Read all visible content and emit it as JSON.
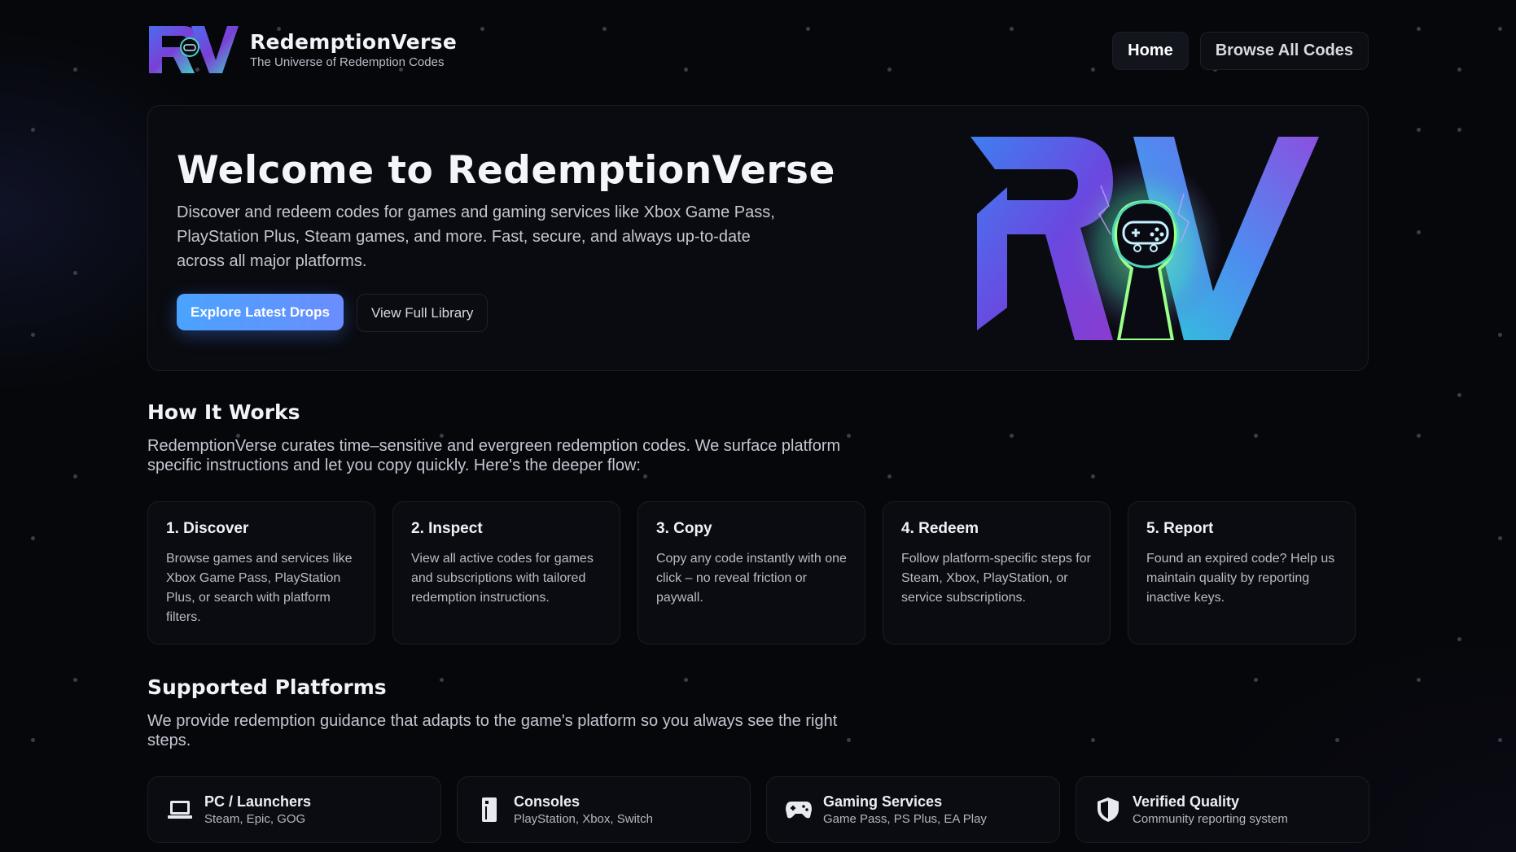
{
  "brand": {
    "name": "RedemptionVerse",
    "tagline": "The Universe of Redemption Codes",
    "logo_letters": "RV"
  },
  "nav": {
    "home": "Home",
    "browse": "Browse All Codes",
    "active": "Home"
  },
  "hero": {
    "title": "Welcome to RedemptionVerse",
    "description": "Discover and redeem codes for games and gaming services like Xbox Game Pass, PlayStation Plus, Steam games, and more. Fast, secure, and always up-to-date across all major platforms.",
    "primary_cta": "Explore Latest Drops",
    "secondary_cta": "View Full Library"
  },
  "how_it_works": {
    "title": "How It Works",
    "description": "RedemptionVerse curates time–sensitive and evergreen redemption codes. We surface platform specific instructions and let you copy quickly. Here's the deeper flow:",
    "steps": [
      {
        "title": "1. Discover",
        "text": "Browse games and services like Xbox Game Pass, PlayStation Plus, or search with platform filters."
      },
      {
        "title": "2. Inspect",
        "text": "View all active codes for games and subscriptions with tailored redemption instructions."
      },
      {
        "title": "3. Copy",
        "text": "Copy any code instantly with one click – no reveal friction or paywall."
      },
      {
        "title": "4. Redeem",
        "text": "Follow platform-specific steps for Steam, Xbox, PlayStation, or service subscriptions."
      },
      {
        "title": "5. Report",
        "text": "Found an expired code? Help us maintain quality by reporting inactive keys."
      }
    ]
  },
  "supported_platforms": {
    "title": "Supported Platforms",
    "description": "We provide redemption guidance that adapts to the game's platform so you always see the right steps.",
    "items": [
      {
        "name": "PC / Launchers",
        "sub": "Steam, Epic, GOG",
        "icon": "laptop-icon"
      },
      {
        "name": "Consoles",
        "sub": "PlayStation, Xbox, Switch",
        "icon": "console-icon"
      },
      {
        "name": "Gaming Services",
        "sub": "Game Pass, PS Plus, EA Play",
        "icon": "gamepad-icon"
      },
      {
        "name": "Verified Quality",
        "sub": "Community reporting system",
        "icon": "shield-icon"
      }
    ]
  },
  "colors": {
    "background": "#06070b",
    "card": "#0b0c11",
    "accent_blue": "#4aa3ff",
    "logo_purple": "#7a3fd6",
    "logo_teal": "#3fd6c8"
  }
}
